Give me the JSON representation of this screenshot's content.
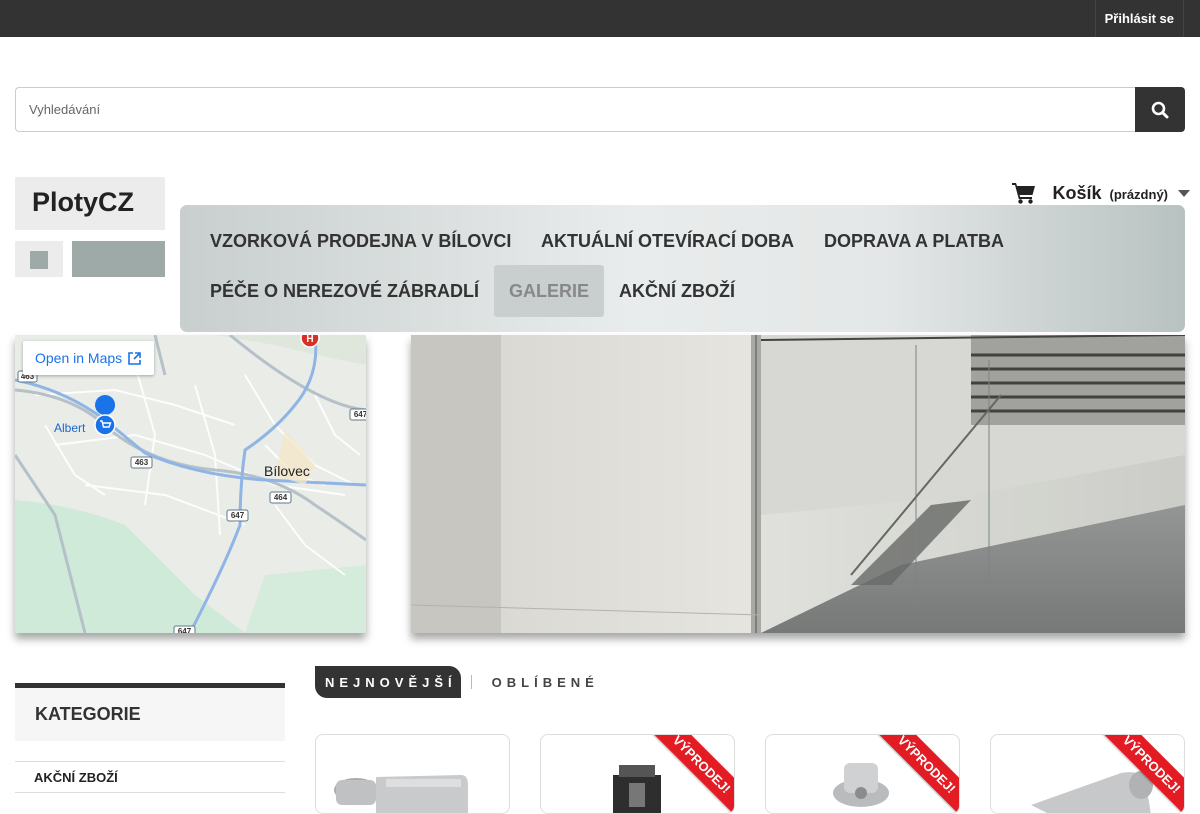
{
  "topbar": {
    "login_label": "Přihlásit se"
  },
  "search": {
    "placeholder": "Vyhledávání"
  },
  "logo": {
    "text": "PlotyCZ"
  },
  "cart": {
    "label": "Košík",
    "status": "(prázdný)"
  },
  "nav": {
    "items": [
      {
        "label": "VZORKOVÁ PRODEJNA V BÍLOVCI"
      },
      {
        "label": "AKTUÁLNÍ OTEVÍRACÍ DOBA"
      },
      {
        "label": "DOPRAVA A PLATBA"
      },
      {
        "label": "PÉČE O NEREZOVÉ ZÁBRADLÍ"
      },
      {
        "label": "GALERIE",
        "active": true
      },
      {
        "label": "AKČNÍ ZBOŽÍ"
      }
    ]
  },
  "map": {
    "open_label": "Open in Maps",
    "place_labels": {
      "albert": "Albert",
      "town": "Bílovec"
    },
    "road_labels": {
      "r463a": "463",
      "r463b": "463",
      "r464": "464",
      "r647a": "647",
      "r647b": "647",
      "r647c": "647"
    }
  },
  "sidebar": {
    "heading": "KATEGORIE",
    "items": [
      {
        "label": "AKČNÍ ZBOŽÍ"
      }
    ]
  },
  "tabs": {
    "newest": "NEJNOVĚJŠÍ",
    "popular": "OBLÍBENÉ"
  },
  "products": [
    {
      "badge": ""
    },
    {
      "badge": "VÝPRODEJ!"
    },
    {
      "badge": "VÝPRODEJ!"
    },
    {
      "badge": "VÝPRODEJ!"
    }
  ],
  "colors": {
    "dark": "#333333",
    "sale_red": "#e31b23",
    "map_link": "#1a73e8"
  }
}
